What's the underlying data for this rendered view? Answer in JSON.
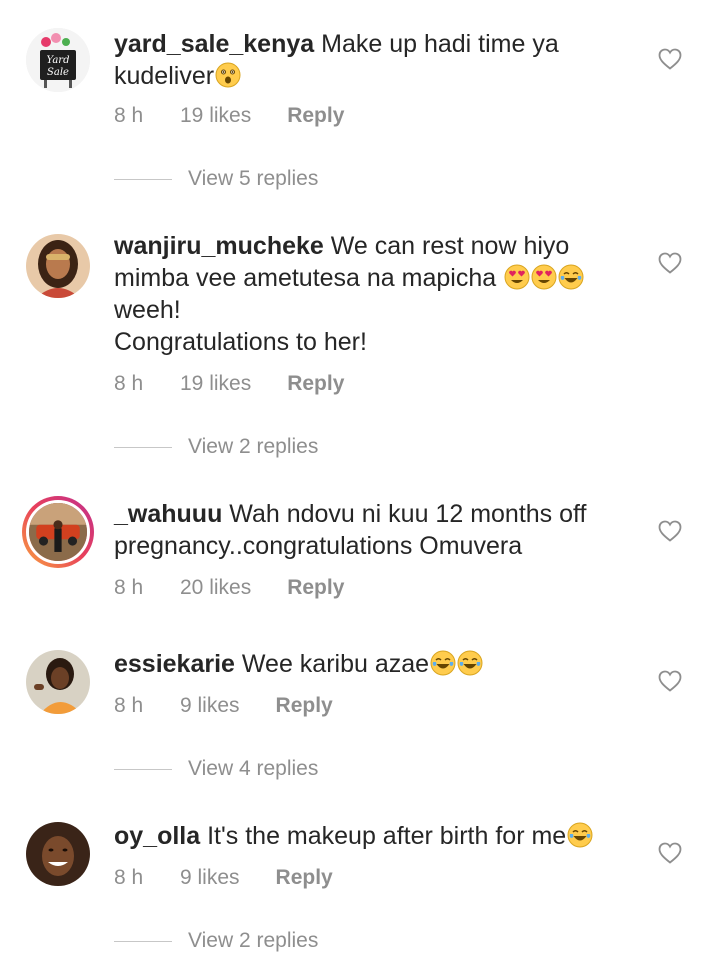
{
  "comments": [
    {
      "username": "yard_sale_kenya",
      "text": "Make up hadi time ya\nkudeliver",
      "emojis": [
        "astonished"
      ],
      "time": "8 h",
      "likes": "19 likes",
      "reply": "Reply",
      "view_replies": "View 5 replies",
      "avatar_sign": [
        "Yard",
        "Sale"
      ]
    },
    {
      "username": "wanjiru_mucheke",
      "text": "We can rest now hiyo\nmimba vee ametutesa na mapicha ",
      "emojis": [
        "heart-eyes",
        "heart-eyes",
        "tears-of-joy"
      ],
      "text_after": "\nweeh!\nCongratulations to her!",
      "time": "8 h",
      "likes": "19 likes",
      "reply": "Reply",
      "view_replies": "View 2 replies"
    },
    {
      "username": "_wahuuu",
      "text": "Wah ndovu ni kuu 12 months off\npregnancy..congratulations  Omuvera",
      "emojis": [],
      "time": "8 h",
      "likes": "20 likes",
      "reply": "Reply"
    },
    {
      "username": "essiekarie",
      "text": "Wee karibu azae",
      "emojis": [
        "tears-of-joy",
        "tears-of-joy"
      ],
      "time": "8 h",
      "likes": "9 likes",
      "reply": "Reply",
      "view_replies": "View 4 replies"
    },
    {
      "username": "oy_olla",
      "text": "It's the makeup after birth for me",
      "emojis": [
        "tears-of-joy"
      ],
      "time": "8 h",
      "likes": "9 likes",
      "reply": "Reply",
      "view_replies": "View 2 replies"
    }
  ],
  "icons": {
    "like": "heart-outline-icon"
  },
  "colors": {
    "text": "#262626",
    "secondary": "#8e8e8e",
    "story_ring_start": "#f9a53f",
    "story_ring_end": "#c02f8e"
  }
}
